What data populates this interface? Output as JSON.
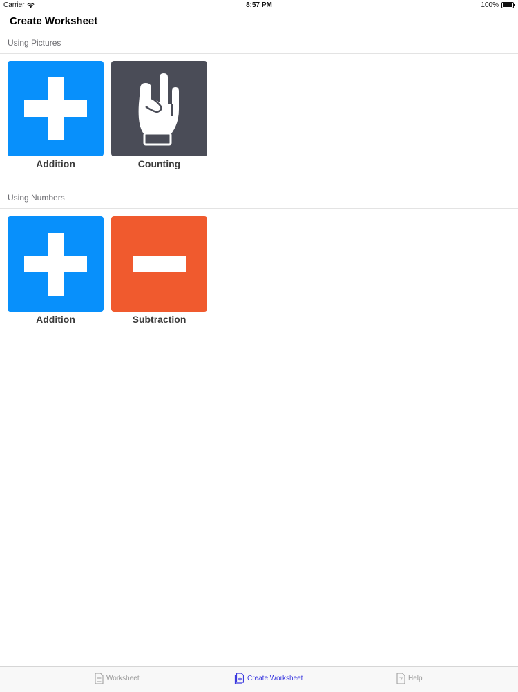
{
  "status": {
    "carrier": "Carrier",
    "time": "8:57 PM",
    "battery": "100%"
  },
  "nav": {
    "title": "Create Worksheet"
  },
  "sections": [
    {
      "header": "Using Pictures",
      "tiles": [
        {
          "label": "Addition",
          "icon": "plus-icon",
          "color": "#0890fb"
        },
        {
          "label": "Counting",
          "icon": "hand-icon",
          "color": "#4a4c57"
        }
      ]
    },
    {
      "header": "Using Numbers",
      "tiles": [
        {
          "label": "Addition",
          "icon": "plus-icon",
          "color": "#0890fb"
        },
        {
          "label": "Subtraction",
          "icon": "minus-icon",
          "color": "#f05a2e"
        }
      ]
    }
  ],
  "tabbar": {
    "items": [
      {
        "label": "Worksheet",
        "icon": "document-icon",
        "active": false
      },
      {
        "label": "Create Worksheet",
        "icon": "add-document-icon",
        "active": true
      },
      {
        "label": "Help",
        "icon": "help-icon",
        "active": false
      }
    ],
    "active_color": "#3c3adf",
    "inactive_color": "#9a9a9a"
  }
}
